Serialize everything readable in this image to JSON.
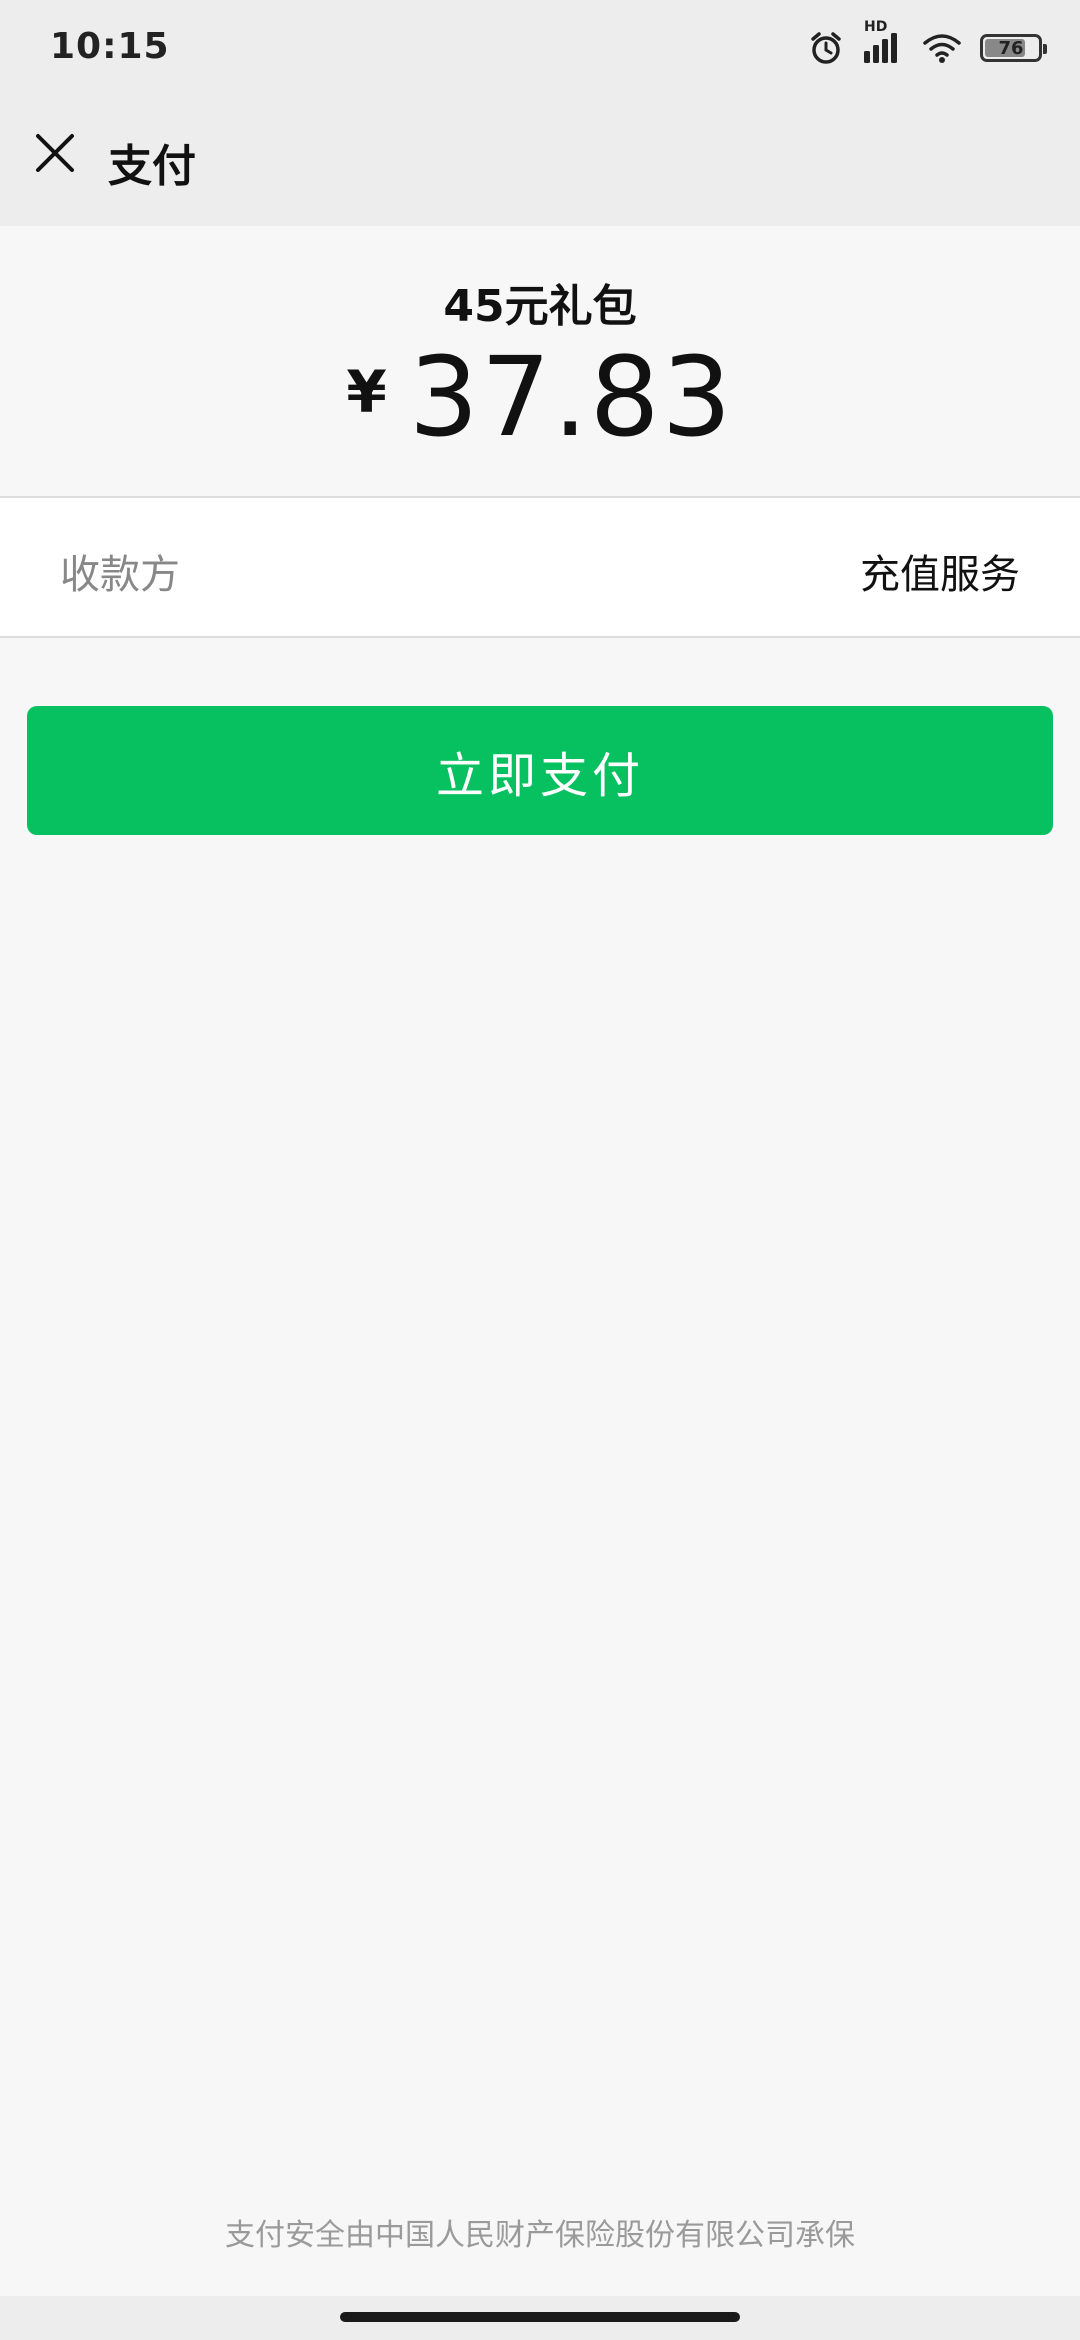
{
  "status_bar": {
    "time": "10:15",
    "network_label": "HD",
    "battery_level": "76",
    "battery_fraction": 0.76,
    "icons": [
      "alarm-icon",
      "signal-icon",
      "wifi-icon",
      "battery-icon"
    ]
  },
  "nav": {
    "close_icon": "close-icon",
    "title": "支付"
  },
  "order": {
    "product_name": "45元礼包",
    "currency_symbol": "¥",
    "amount": "37.83"
  },
  "payee": {
    "label": "收款方",
    "value": "充值服务"
  },
  "actions": {
    "pay_label": "立即支付"
  },
  "footer": {
    "security_note": "支付安全由中国人民财产保险股份有限公司承保"
  },
  "colors": {
    "primary_green": "#07c160",
    "header_bg": "#ededed",
    "page_bg": "#f7f7f7",
    "muted_text": "#888888"
  }
}
